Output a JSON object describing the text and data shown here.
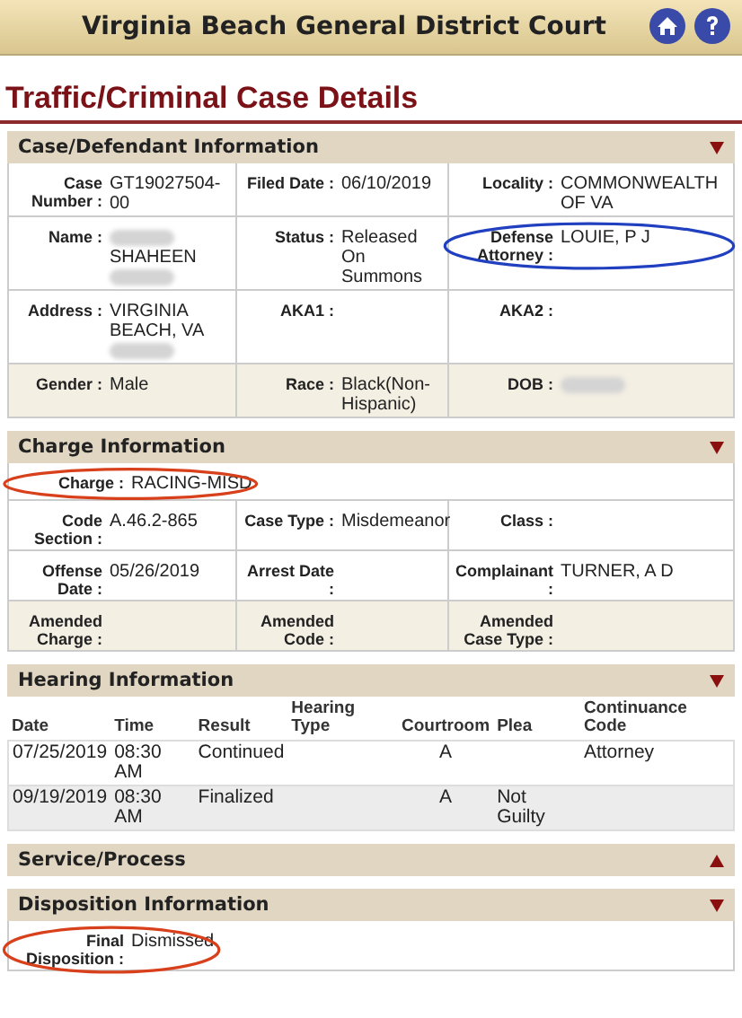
{
  "header": {
    "title": "Virginia Beach General District Court"
  },
  "page_title": "Traffic/Criminal Case Details",
  "sections": [
    {
      "kind": "fields",
      "title": "Case/Defendant Information",
      "expanded": true,
      "rows": [
        {
          "shaded": false,
          "cells": [
            {
              "label": "Case Number :",
              "parts": [
                {
                  "kind": "text",
                  "text": "GT19027504-00"
                }
              ]
            },
            {
              "label": "Filed Date :",
              "parts": [
                {
                  "kind": "text",
                  "text": "06/10/2019"
                }
              ]
            },
            {
              "label": "Locality :",
              "parts": [
                {
                  "kind": "text",
                  "text": "COMMONWEALTH OF VA"
                }
              ]
            }
          ]
        },
        {
          "shaded": false,
          "cells": [
            {
              "label": "Name :",
              "parts": [
                {
                  "kind": "redacted"
                },
                {
                  "kind": "text",
                  "text": "SHAHEEN"
                },
                {
                  "kind": "redacted"
                }
              ]
            },
            {
              "label": "Status :",
              "parts": [
                {
                  "kind": "text",
                  "text": "Released On Summons"
                }
              ]
            },
            {
              "label": "Defense Attorney :",
              "parts": [
                {
                  "kind": "text",
                  "text": "LOUIE, P J"
                }
              ],
              "annotation": {
                "color": "#2040c0"
              }
            }
          ]
        },
        {
          "shaded": false,
          "cells": [
            {
              "label": "Address :",
              "parts": [
                {
                  "kind": "text",
                  "text": "VIRGINIA BEACH, VA"
                },
                {
                  "kind": "redacted"
                }
              ]
            },
            {
              "label": "AKA1 :"
            },
            {
              "label": "AKA2 :"
            }
          ]
        },
        {
          "shaded": true,
          "cells": [
            {
              "label": "Gender :",
              "parts": [
                {
                  "kind": "text",
                  "text": "Male"
                }
              ]
            },
            {
              "label": "Race :",
              "parts": [
                {
                  "kind": "text",
                  "text": "Black(Non-Hispanic)"
                }
              ]
            },
            {
              "label": "DOB :",
              "parts": [
                {
                  "kind": "redacted"
                }
              ]
            }
          ]
        }
      ]
    },
    {
      "kind": "fields",
      "title": "Charge Information",
      "expanded": true,
      "rows": [
        {
          "shaded": false,
          "cells": [
            {
              "label": "Charge :",
              "parts": [
                {
                  "kind": "text",
                  "text": "RACING-MISD"
                }
              ],
              "annotation": {
                "color": "#d8401c"
              }
            }
          ]
        },
        {
          "shaded": false,
          "cells": [
            {
              "label": "Code Section :",
              "parts": [
                {
                  "kind": "text",
                  "text": "A.46.2-865"
                }
              ]
            },
            {
              "label": "Case Type :",
              "parts": [
                {
                  "kind": "text",
                  "text": "Misdemeanor"
                }
              ]
            },
            {
              "label": "Class :"
            }
          ]
        },
        {
          "shaded": false,
          "cells": [
            {
              "label": "Offense Date :",
              "parts": [
                {
                  "kind": "text",
                  "text": "05/26/2019"
                }
              ]
            },
            {
              "label": "Arrest Date :"
            },
            {
              "label": "Complainant :",
              "parts": [
                {
                  "kind": "text",
                  "text": "TURNER, A D"
                }
              ]
            }
          ]
        },
        {
          "shaded": true,
          "cells": [
            {
              "label": "Amended Charge :"
            },
            {
              "label": "Amended Code :"
            },
            {
              "label": "Amended Case Type :"
            }
          ]
        }
      ]
    },
    {
      "kind": "table",
      "title": "Hearing Information",
      "expanded": true,
      "columns": [
        "Date",
        "Time",
        "Result",
        "Hearing Type",
        "Courtroom",
        "Plea",
        "Continuance Code"
      ],
      "rows": [
        [
          "07/25/2019",
          "08:30 AM",
          "Continued",
          "",
          "A",
          "",
          "Attorney"
        ],
        [
          "09/19/2019",
          "08:30 AM",
          "Finalized",
          "",
          "A",
          "Not Guilty",
          ""
        ]
      ]
    },
    {
      "kind": "collapsed",
      "title": "Service/Process",
      "expanded": false
    },
    {
      "kind": "fields",
      "title": "Disposition Information",
      "expanded": true,
      "rows": [
        {
          "shaded": false,
          "cells": [
            {
              "label": "Final Disposition :",
              "parts": [
                {
                  "kind": "text",
                  "text": "Dismissed"
                }
              ],
              "annotation": {
                "color": "#d8401c"
              }
            }
          ]
        }
      ]
    }
  ]
}
